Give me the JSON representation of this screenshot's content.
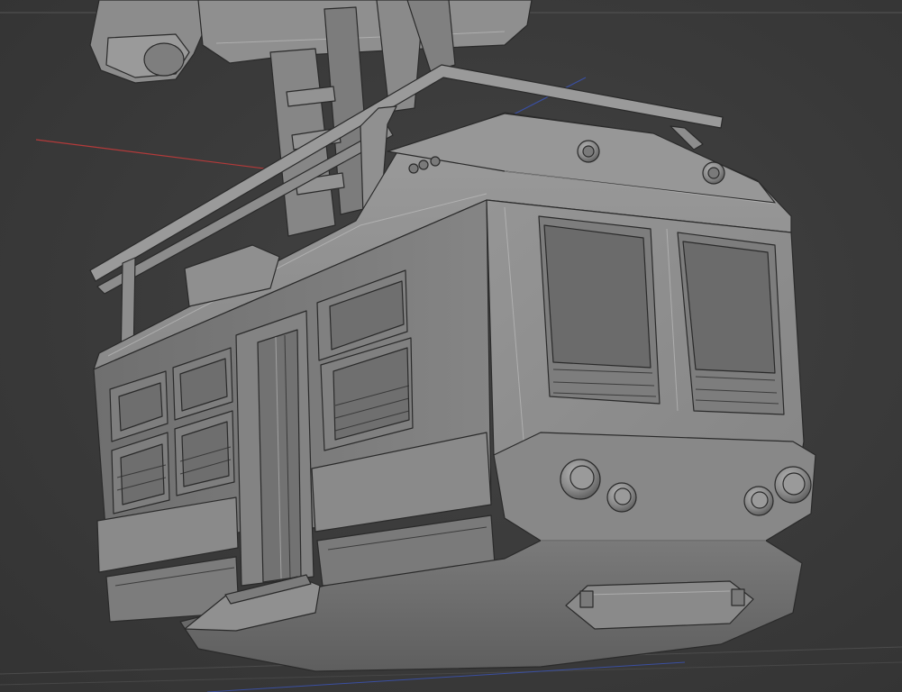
{
  "scene": {
    "background_color": "#393939",
    "model_base_color": "#8e8e8e",
    "axis_colors": {
      "x_axis": "#b33a3a",
      "y_axis": "#4d7a3a",
      "z_axis": "#3a4fa0"
    },
    "icons": {
      "viewport": "3d-viewport-icon",
      "model": "cable-car-mesh-icon"
    }
  }
}
